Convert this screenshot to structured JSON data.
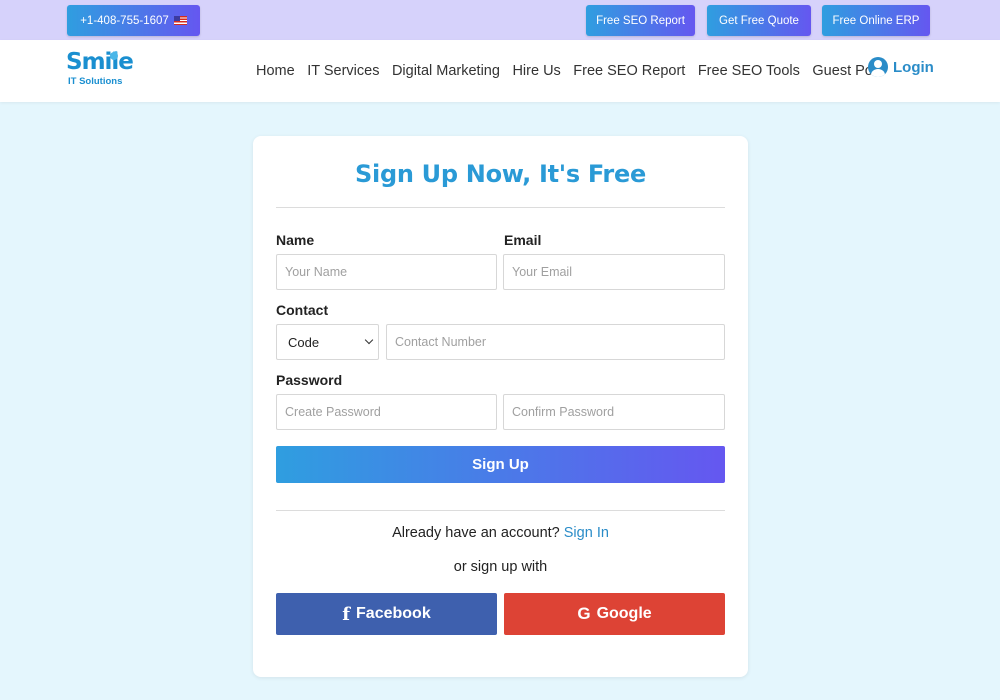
{
  "topbar": {
    "phone": "+1-408-755-1607",
    "buttons": {
      "seo_report": "Free SEO Report",
      "free_quote": "Get Free Quote",
      "online_erp": "Free Online ERP"
    }
  },
  "logo": {
    "word": "Smile",
    "sub": "IT Solutions"
  },
  "nav": {
    "items": [
      "Home",
      "IT Services",
      "Digital Marketing",
      "Hire Us",
      "Free SEO Report",
      "Free SEO Tools",
      "Guest Post"
    ],
    "login": "Login"
  },
  "form": {
    "title": "Sign Up Now, It's Free",
    "name_label": "Name",
    "name_placeholder": "Your Name",
    "email_label": "Email",
    "email_placeholder": "Your Email",
    "contact_label": "Contact",
    "code_selected": "Code",
    "contact_placeholder": "Contact Number",
    "password_label": "Password",
    "create_password_placeholder": "Create Password",
    "confirm_password_placeholder": "Confirm Password",
    "submit_label": "Sign Up",
    "already_text": "Already have an account?",
    "signin_link": "Sign In",
    "or_text": "or sign up with",
    "facebook_label": "Facebook",
    "google_label": "Google"
  },
  "icons": {
    "flag": "us-flag-icon",
    "user": "user-circle-icon",
    "facebook": "facebook-icon",
    "google": "google-icon"
  },
  "colors": {
    "brand": "#2a9ad6",
    "gradient_start": "#2f9ee0",
    "gradient_end": "#6557f0",
    "facebook": "#3e60ae",
    "google": "#dd4335",
    "page_bg": "#e4f6fd",
    "topbar_bg": "#d6d2fb"
  }
}
